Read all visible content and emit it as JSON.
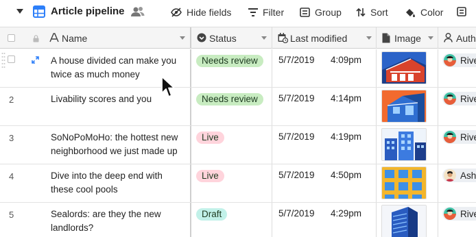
{
  "toolbar": {
    "title": "Article pipeline",
    "hide_fields": "Hide fields",
    "filter": "Filter",
    "group": "Group",
    "sort": "Sort",
    "color": "Color"
  },
  "columns": {
    "name": "Name",
    "status": "Status",
    "last_modified": "Last modified",
    "image": "Image",
    "author": "Auth"
  },
  "status_colors": {
    "Needs review": "#c8ecc1",
    "Live": "#ffd4dc",
    "Draft": "#c2f1e9"
  },
  "rows": [
    {
      "num": "",
      "name": "A house divided can make you twice as much money",
      "status": "Needs review",
      "date": "5/7/2019",
      "time": "4:09pm",
      "image": "red-house",
      "author": "Rive",
      "avatar": "avatar-rive"
    },
    {
      "num": "2",
      "name": "Livability scores and you",
      "status": "Needs review",
      "date": "5/7/2019",
      "time": "4:14pm",
      "image": "blue-house-orange-sky",
      "author": "Rive",
      "avatar": "avatar-rive"
    },
    {
      "num": "3",
      "name": "SoNoPoMoHo: the hottest new neighborhood we just made up",
      "status": "Live",
      "date": "5/7/2019",
      "time": "4:19pm",
      "image": "blue-buildings",
      "author": "Rive",
      "avatar": "avatar-rive"
    },
    {
      "num": "4",
      "name": "Dive into the deep end with these cool pools",
      "status": "Live",
      "date": "5/7/2019",
      "time": "4:50pm",
      "image": "yellow-facade",
      "author": "Ash",
      "avatar": "avatar-ash"
    },
    {
      "num": "5",
      "name": "Sealords: are they the new landlords?",
      "status": "Draft",
      "date": "5/7/2019",
      "time": "4:29pm",
      "image": "blue-tower",
      "author": "Rive",
      "avatar": "avatar-rive"
    }
  ]
}
